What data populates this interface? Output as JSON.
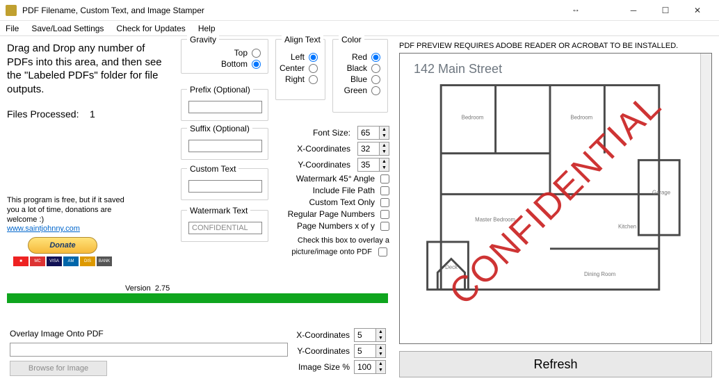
{
  "window": {
    "title": "PDF Filename, Custom Text, and Image Stamper"
  },
  "menu": {
    "file": "File",
    "saveload": "Save/Load Settings",
    "updates": "Check for Updates",
    "help": "Help"
  },
  "drop_message": "Drag and Drop any number of PDFs into this area, and then see the \"Labeled PDFs\" folder for file outputs.",
  "files_processed": {
    "label": "Files Processed:",
    "value": "1"
  },
  "blurb": {
    "line1": "This program is free, but if it saved you a lot of time, donations are welcome :)",
    "link": "www.saintjohnny.com"
  },
  "donate_label": "Donate",
  "version": {
    "label": "Version",
    "value": "2.75"
  },
  "overlay": {
    "header": "Overlay Image Onto PDF",
    "browse": "Browse for Image",
    "x_label": "X-Coordinates",
    "y_label": "Y-Coordinates",
    "size_label": "Image Size %",
    "x": "5",
    "y": "5",
    "size": "100"
  },
  "groups": {
    "gravity": {
      "title": "Gravity",
      "top": "Top",
      "bottom": "Bottom",
      "selected": "bottom"
    },
    "align": {
      "title": "Align Text",
      "left": "Left",
      "center": "Center",
      "right": "Right",
      "selected": "left"
    },
    "color": {
      "title": "Color",
      "red": "Red",
      "black": "Black",
      "blue": "Blue",
      "green": "Green",
      "selected": "red"
    },
    "prefix": {
      "title": "Prefix (Optional)",
      "value": ""
    },
    "suffix": {
      "title": "Suffix (Optional)",
      "value": ""
    },
    "custom": {
      "title": "Custom Text",
      "value": ""
    },
    "water": {
      "title": "Watermark Text",
      "value": "CONFIDENTIAL"
    }
  },
  "settings": {
    "font_label": "Font Size:",
    "font": "65",
    "x_label": "X-Coordinates",
    "x": "32",
    "y_label": "Y-Coordinates",
    "y": "35",
    "chk_angle": "Watermark 45° Angle",
    "chk_path": "Include File Path",
    "chk_custom": "Custom Text Only",
    "chk_pages": "Regular Page Numbers",
    "chk_xofy": "Page Numbers x of y",
    "overlay_note": "Check this box to overlay a picture/image onto PDF"
  },
  "preview": {
    "note": "PDF PREVIEW REQUIRES ADOBE READER OR ACROBAT TO BE INSTALLED.",
    "address": "142 Main Street",
    "watermark": "CONFIDENTIAL",
    "refresh": "Refresh"
  }
}
